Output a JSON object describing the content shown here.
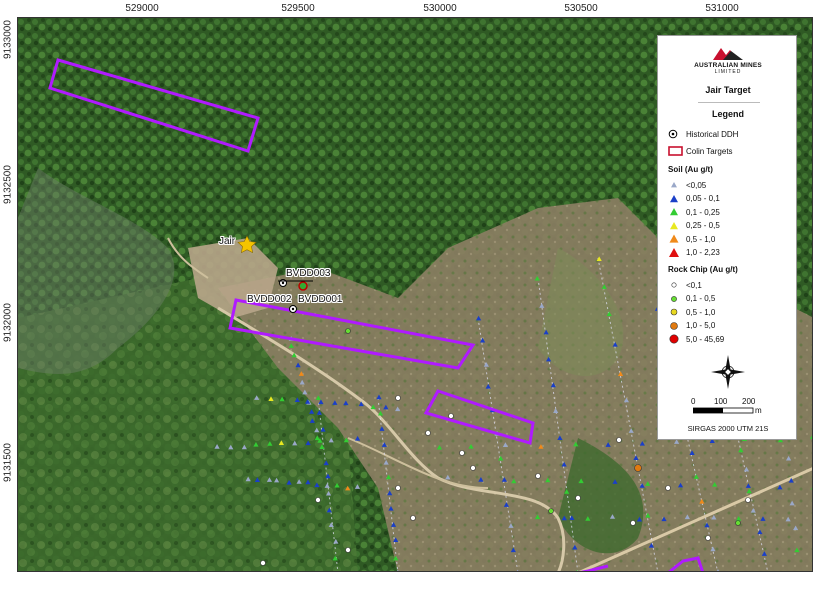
{
  "axes": {
    "x_ticks": [
      "529000",
      "529500",
      "530000",
      "530500",
      "531000"
    ],
    "y_ticks": [
      "9133000",
      "9132500",
      "9132000",
      "9131500"
    ]
  },
  "map_labels": {
    "jair": "Jair",
    "bvdd003": "BVDD003",
    "bvdd002": "BVDD002",
    "bvdd001": "BVDD001"
  },
  "legend": {
    "logo_text": "AUSTRALIAN MINES",
    "logo_sub": "LIMITED",
    "map_title": "Jair Target",
    "legend_title": "Legend",
    "historical_ddh": "Historical DDH",
    "colin_targets": "Colin Targets",
    "soil_heading": "Soil (Au g/t)",
    "soil_classes": [
      "<0,05",
      "0,05 - 0,1",
      "0,1 - 0,25",
      "0,25 - 0,5",
      "0,5 - 1,0",
      "1,0 - 2,23"
    ],
    "rock_heading": "Rock Chip (Au g/t)",
    "rock_classes": [
      "<0,1",
      "0,1 - 0,5",
      "0,5 - 1,0",
      "1,0 - 5,0",
      "5,0 - 45,69"
    ],
    "north_label": "N",
    "scale_0": "0",
    "scale_100": "100",
    "scale_200": "200",
    "scale_unit": "m",
    "crs": "SIRGAS 2000 UTM 21S"
  },
  "colors": {
    "target_outline": "#b01aff",
    "soil": [
      "#9aa8c8",
      "#1a3fc8",
      "#33cc33",
      "#e8e820",
      "#f08a1a",
      "#e01010"
    ],
    "rock": [
      "#ffffff",
      "#66dd33",
      "#e8d820",
      "#e07a10",
      "#e00000"
    ],
    "star": "#f5c400"
  }
}
